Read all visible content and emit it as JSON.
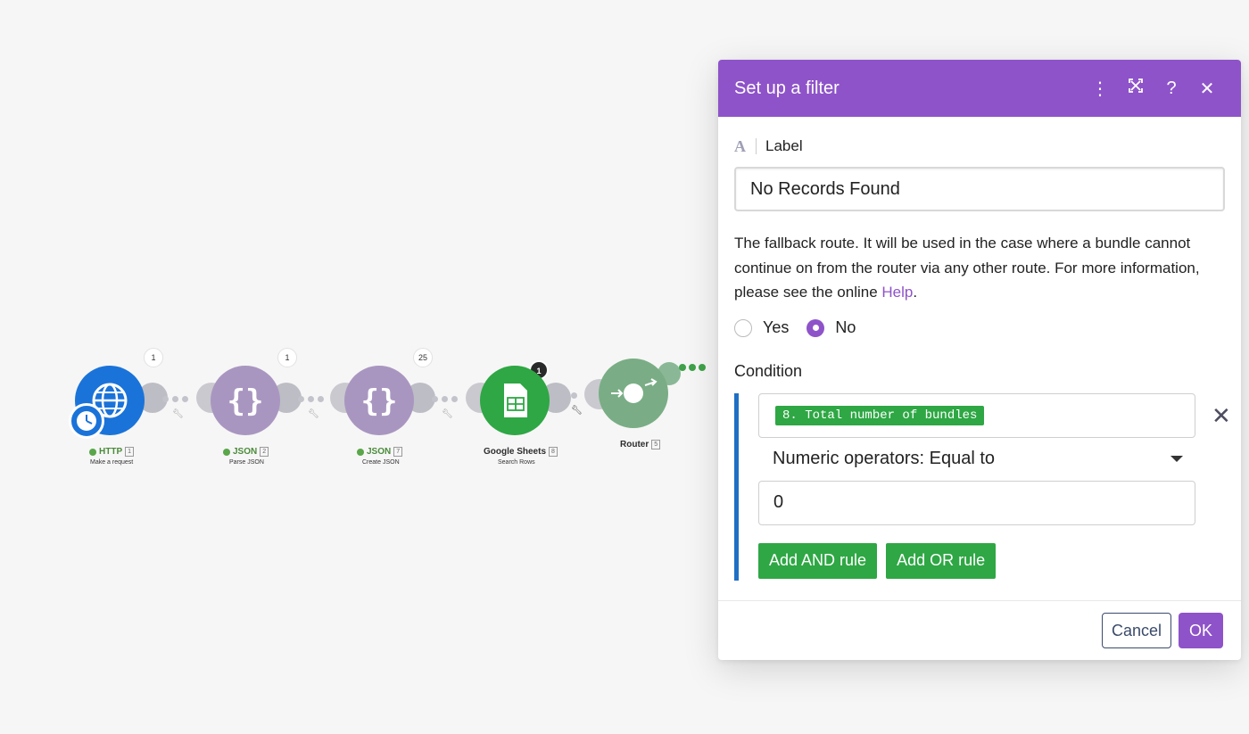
{
  "scenario": {
    "modules": [
      {
        "title": "HTTP",
        "number": "1",
        "subtitle": "Make a request",
        "badge": "1",
        "icon": "globe-icon",
        "color": "#1a73d9"
      },
      {
        "title": "JSON",
        "number": "2",
        "subtitle": "Parse JSON",
        "badge": "1",
        "icon": "braces-icon",
        "color": "#a996c0"
      },
      {
        "title": "JSON",
        "number": "7",
        "subtitle": "Create JSON",
        "badge": "25",
        "icon": "braces-icon",
        "color": "#a996c0"
      },
      {
        "title": "Google Sheets",
        "number": "8",
        "subtitle": "Search Rows",
        "badge": "1",
        "icon": "sheets-icon",
        "color": "#2ea744"
      },
      {
        "title": "Router",
        "number": "5",
        "icon": "router-icon",
        "color": "#7aad85"
      }
    ]
  },
  "dialog": {
    "title": "Set up a filter",
    "label_caption": "Label",
    "label_value": "No Records Found",
    "fallback_text": "The fallback route. It will be used in the case where a bundle cannot continue on from the router via any other route. For more information, please see the online ",
    "help_link": "Help",
    "fallback_end": ".",
    "fallback_yes": "Yes",
    "fallback_no": "No",
    "fallback_selected": "No",
    "condition_title": "Condition",
    "operand_pill": "8. Total number of bundles",
    "operator": "Numeric operators: Equal to",
    "value": "0",
    "add_and": "Add AND rule",
    "add_or": "Add OR rule",
    "cancel": "Cancel",
    "ok": "OK",
    "header_color": "#8e53c9",
    "accent_green": "#2ea744"
  }
}
